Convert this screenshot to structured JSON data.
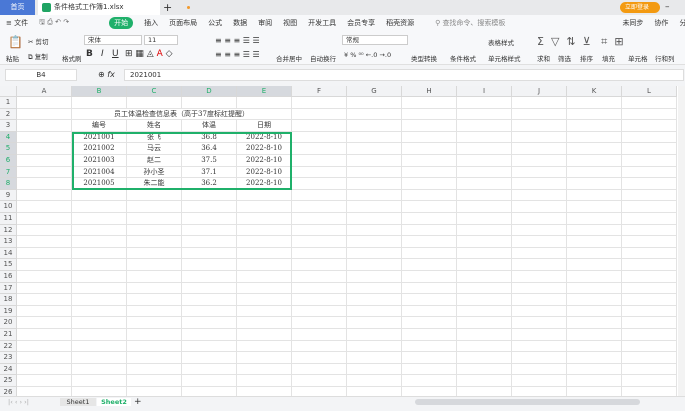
{
  "tabs": {
    "home": "首页",
    "file": "条件格式工作簿1.xlsx",
    "new_tab": "+",
    "login": "立即登录"
  },
  "menu": {
    "file": "≡ 文件",
    "items": [
      "开始",
      "插入",
      "页面布局",
      "公式",
      "数据",
      "审阅",
      "视图",
      "开发工具",
      "会员专享",
      "稻壳资源"
    ],
    "search_placeholder": "查找命令、搜索模板",
    "sync": "未同步",
    "collab": "协作",
    "share": "分享"
  },
  "toolbar": {
    "paste": "粘贴",
    "cut": "剪切",
    "copy": "复制",
    "format_painter": "格式刷",
    "font": "宋体",
    "size": "11",
    "merge": "合并居中",
    "wrap": "自动换行",
    "number_format": "常规",
    "convert": "类型转换",
    "cond_format": "条件格式",
    "table_style": "表格样式",
    "cell_style": "单元格样式",
    "sum": "求和",
    "filter": "筛选",
    "sort": "排序",
    "fill": "填充",
    "cell": "单元格",
    "rowcol": "行和列",
    "bold": "B",
    "italic": "I",
    "underline": "U"
  },
  "formula_bar": {
    "name_box": "B4",
    "fx": "fx",
    "value": "2021001"
  },
  "columns": [
    "A",
    "B",
    "C",
    "D",
    "E",
    "F",
    "G",
    "H",
    "I",
    "J",
    "K",
    "L"
  ],
  "sheet": {
    "title": "员工体温检查信息表（高于37度标红提醒）",
    "headers": [
      "编号",
      "姓名",
      "体温",
      "日期"
    ],
    "rows": [
      [
        "2021001",
        "张飞",
        "36.8",
        "2022-8-10"
      ],
      [
        "2021002",
        "马云",
        "36.4",
        "2022-8-10"
      ],
      [
        "2021003",
        "赵二",
        "37.5",
        "2022-8-10"
      ],
      [
        "2021004",
        "孙小圣",
        "37.1",
        "2022-8-10"
      ],
      [
        "2021005",
        "朱二能",
        "36.2",
        "2022-8-10"
      ]
    ]
  },
  "sheet_tabs": [
    "Sheet1",
    "Sheet2"
  ],
  "active_sheet": "Sheet2",
  "colors": {
    "accent": "#1fb06a",
    "title_fill": "#ed7d31",
    "header_fill": "#ffe699",
    "data_fill": "#d9d9d9",
    "login": "#f39a11"
  }
}
